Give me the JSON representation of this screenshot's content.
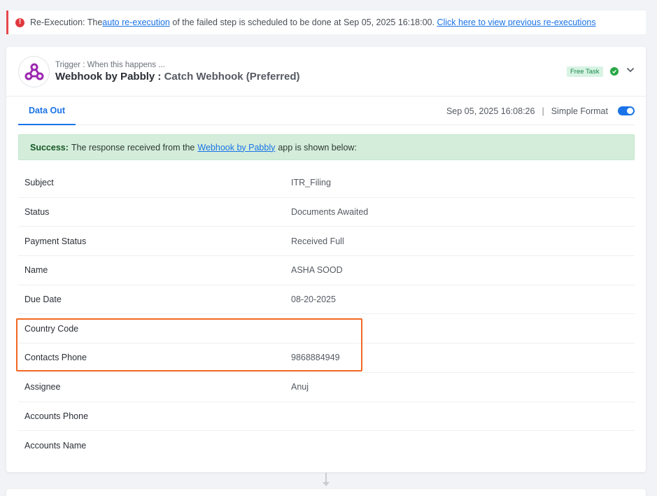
{
  "notice": {
    "prefix": "Re-Execution: The ",
    "link1": "auto re-execution",
    "middle": " of the failed step is scheduled to be done at Sep 05, 2025 16:18:00. ",
    "link2": "Click here to view previous re-executions",
    "icon": "exclamation-circle-icon",
    "color": "#e5484d"
  },
  "trigger": {
    "subtitle": "Trigger : When this happens ...",
    "app": "Webhook by Pabbly :",
    "event": "Catch Webhook (Preferred)",
    "badge": "Free Task",
    "logo_icon": "webhook-logo-icon",
    "brand_color": "#9c27b0"
  },
  "tabs": {
    "active": "Data Out",
    "timestamp": "Sep 05, 2025 16:08:26",
    "separator": "|",
    "format_label": "Simple Format",
    "accent": "#1a73e8"
  },
  "success": {
    "label": "Success:",
    "text1": "The response received from the",
    "link": "Webhook by Pabbly",
    "text2": "app is shown below:"
  },
  "rows": [
    {
      "key": "Subject",
      "value": "ITR_Filing"
    },
    {
      "key": "Status",
      "value": "Documents Awaited"
    },
    {
      "key": "Payment Status",
      "value": "Received Full"
    },
    {
      "key": "Name",
      "value": "ASHA SOOD"
    },
    {
      "key": "Due Date",
      "value": "08-20-2025"
    },
    {
      "key": "Country Code",
      "value": ""
    },
    {
      "key": "Contacts Phone",
      "value": "9868884949"
    },
    {
      "key": "Assignee",
      "value": "Anuj"
    },
    {
      "key": "Accounts Phone",
      "value": ""
    },
    {
      "key": "Accounts Name",
      "value": ""
    }
  ],
  "highlight_color": "#f26722"
}
